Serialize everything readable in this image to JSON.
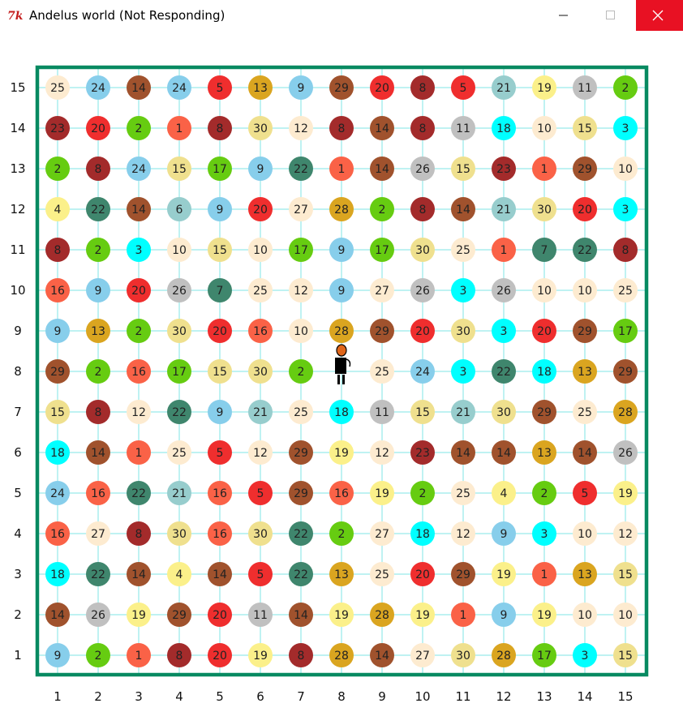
{
  "window": {
    "title": "Andelus world (Not Responding)",
    "controls": [
      "minimize",
      "maximize",
      "close"
    ],
    "close_color": "#e81123"
  },
  "board": {
    "grid_size": 15,
    "border_color": "#078a61",
    "grid_line_color": "#7fe5e5",
    "x_labels": [
      "1",
      "2",
      "3",
      "4",
      "5",
      "6",
      "7",
      "8",
      "9",
      "10",
      "11",
      "12",
      "13",
      "14",
      "15"
    ],
    "y_labels": [
      "1",
      "2",
      "3",
      "4",
      "5",
      "6",
      "7",
      "8",
      "9",
      "10",
      "11",
      "12",
      "13",
      "14",
      "15"
    ],
    "player": {
      "col": 8,
      "row": 8,
      "icon": "person-icon"
    },
    "rows_top_to_bottom": [
      [
        25,
        24,
        14,
        24,
        5,
        13,
        9,
        29,
        20,
        8,
        5,
        21,
        19,
        11,
        2
      ],
      [
        23,
        20,
        2,
        1,
        8,
        30,
        12,
        8,
        14,
        8,
        11,
        18,
        10,
        15,
        3
      ],
      [
        2,
        8,
        24,
        15,
        17,
        9,
        22,
        1,
        14,
        26,
        15,
        23,
        1,
        29,
        10
      ],
      [
        4,
        22,
        14,
        6,
        9,
        20,
        27,
        28,
        2,
        8,
        14,
        21,
        30,
        20,
        3
      ],
      [
        8,
        2,
        3,
        10,
        15,
        10,
        17,
        9,
        17,
        30,
        25,
        1,
        7,
        22,
        8
      ],
      [
        16,
        9,
        20,
        26,
        7,
        25,
        12,
        9,
        27,
        26,
        3,
        26,
        10,
        10,
        25
      ],
      [
        9,
        13,
        2,
        30,
        20,
        16,
        10,
        28,
        29,
        20,
        30,
        3,
        20,
        29,
        17
      ],
      [
        29,
        2,
        16,
        17,
        15,
        30,
        2,
        null,
        25,
        24,
        3,
        22,
        18,
        13,
        29
      ],
      [
        15,
        8,
        12,
        22,
        9,
        21,
        25,
        18,
        11,
        15,
        21,
        30,
        29,
        25,
        28
      ],
      [
        18,
        14,
        1,
        25,
        5,
        12,
        29,
        19,
        12,
        23,
        14,
        14,
        13,
        14,
        26
      ],
      [
        24,
        16,
        22,
        21,
        16,
        5,
        29,
        16,
        19,
        2,
        25,
        4,
        2,
        5,
        19
      ],
      [
        16,
        27,
        8,
        30,
        16,
        30,
        22,
        2,
        27,
        18,
        12,
        9,
        3,
        10,
        12
      ],
      [
        18,
        22,
        14,
        4,
        14,
        5,
        22,
        13,
        25,
        20,
        29,
        19,
        1,
        13,
        15
      ],
      [
        14,
        26,
        19,
        29,
        20,
        11,
        14,
        19,
        28,
        19,
        1,
        9,
        19,
        10,
        10
      ],
      [
        9,
        2,
        1,
        8,
        20,
        19,
        8,
        28,
        14,
        27,
        30,
        28,
        17,
        3,
        15
      ]
    ]
  },
  "value_colors": {
    "1": "#fa6247",
    "2": "#66cc11",
    "3": "#00ffff",
    "4": "#fbf08a",
    "5": "#ef2e2e",
    "6": "#97cdcd",
    "7": "#3f866d",
    "8": "#a32b2b",
    "9": "#87ceeb",
    "10": "#fdebd0",
    "11": "#c0c0c0",
    "12": "#fdebd0",
    "13": "#daa520",
    "14": "#a0522d",
    "15": "#efe08e",
    "16": "#fa6247",
    "17": "#66cc11",
    "18": "#00ffff",
    "19": "#fbf08a",
    "20": "#ef2e2e",
    "21": "#97cdcd",
    "22": "#3f866d",
    "23": "#a32b2b",
    "24": "#87ceeb",
    "25": "#fdebd0",
    "26": "#c0c0c0",
    "27": "#fdebd0",
    "28": "#daa520",
    "29": "#a0522d",
    "30": "#efe08e"
  }
}
